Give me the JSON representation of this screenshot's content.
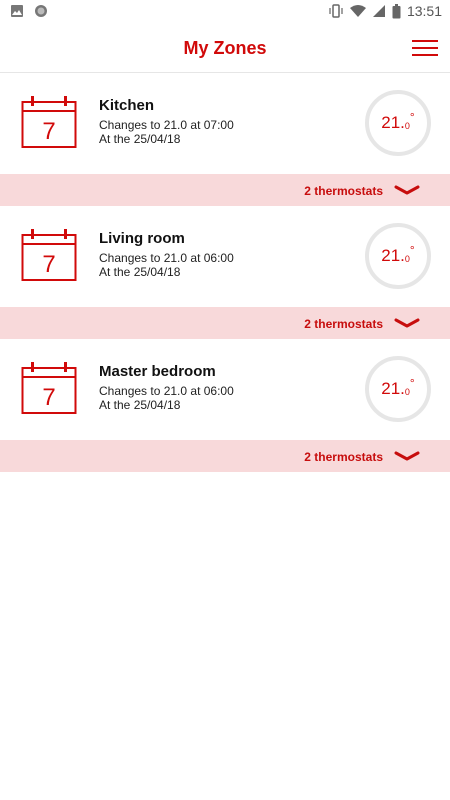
{
  "status_bar": {
    "time": "13:51",
    "icons": [
      "image-icon",
      "circle-icon",
      "vibrate-icon",
      "wifi-icon",
      "signal-icon",
      "battery-icon"
    ]
  },
  "header": {
    "title": "My Zones",
    "menu_icon": "hamburger-menu-icon"
  },
  "colors": {
    "accent": "#d10a0a",
    "thermostat_bar": "#f8d9da",
    "dial_ring": "#e6e6e6"
  },
  "zones": [
    {
      "name": "Kitchen",
      "calendar_day": "7",
      "change": "Changes to 21.0 at 07:00",
      "date": "At the 25/04/18",
      "temp_main": "21.",
      "temp_dec": "0",
      "temp_unit": "°",
      "thermostats": "2 thermostats"
    },
    {
      "name": "Living room",
      "calendar_day": "7",
      "change": "Changes to 21.0 at 06:00",
      "date": "At the 25/04/18",
      "temp_main": "21.",
      "temp_dec": "0",
      "temp_unit": "°",
      "thermostats": "2 thermostats"
    },
    {
      "name": "Master bedroom",
      "calendar_day": "7",
      "change": "Changes to 21.0 at 06:00",
      "date": "At the 25/04/18",
      "temp_main": "21.",
      "temp_dec": "0",
      "temp_unit": "°",
      "thermostats": "2 thermostats"
    }
  ]
}
